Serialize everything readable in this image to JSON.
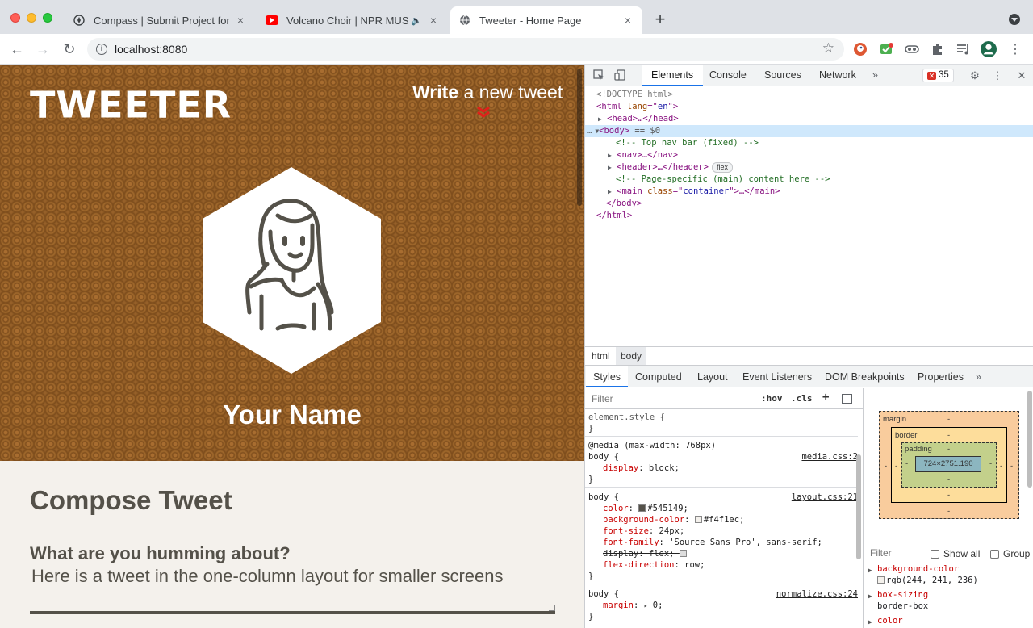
{
  "browser": {
    "tabs": [
      {
        "title": "Compass | Submit Project for E",
        "icon": "compass-icon",
        "active": false
      },
      {
        "title": "Volcano Choir | NPR MUSIC",
        "icon": "youtube-icon",
        "active": false,
        "audio": true
      },
      {
        "title": "Tweeter - Home Page",
        "icon": "globe-icon",
        "active": true
      }
    ],
    "url": "localhost:8080"
  },
  "page": {
    "logo": "TWEETER",
    "write_bold": "Write",
    "write_rest": " a new tweet",
    "name": "Your Name",
    "compose_title": "Compose Tweet",
    "question": "What are you humming about?",
    "tweet_text": "Here is a tweet in the one-column layout for smaller screens",
    "colors": {
      "hero": "#8e5a24",
      "accent": "#e0201a",
      "body_bg": "#f4f1ec",
      "text": "#545149"
    }
  },
  "devtools": {
    "tabs": [
      "Elements",
      "Console",
      "Sources",
      "Network"
    ],
    "more": "»",
    "error_count": "35",
    "dom": {
      "doctype": "<!DOCTYPE html>",
      "html_open_tag": "<html",
      "lang_attr": " lang",
      "lang_eq": "=\"",
      "lang_val": "en",
      "lang_close": "\">",
      "head_line": "<head>…</head>",
      "body_open": "<body>",
      "body_suffix": " == $0",
      "dots": "…",
      "comment1": "<!-- Top nav bar (fixed) -->",
      "nav_line": "<nav>…</nav>",
      "header_line": "<header>…</header>",
      "flex_pill": "flex",
      "comment2": "<!-- Page-specific (main) content here -->",
      "main_tag": "<main",
      "class_attr": " class",
      "main_eq": "=\"",
      "class_val": "container",
      "main_end": "\">…</main>",
      "body_close": "</body>",
      "html_close": "</html>"
    },
    "breadcrumbs": [
      "html",
      "body"
    ],
    "style_tabs": [
      "Styles",
      "Computed",
      "Layout",
      "Event Listeners",
      "DOM Breakpoints",
      "Properties"
    ],
    "styles": {
      "filter": "Filter",
      "hov": ":hov",
      "cls": ".cls",
      "plus": "+",
      "element_style": "element.style {",
      "close": "}",
      "media": "@media (max-width: 768px)",
      "r1_sel": "body {",
      "r1_src": "media.css:2",
      "r1_prop": "display",
      "r1_val": ": block;",
      "r2_sel": "body {",
      "r2_src": "layout.css:21",
      "color_prop": "color",
      "color_val": "#545149;",
      "bg_prop": "background-color",
      "bg_val": "#f4f1ec;",
      "fs_prop": "font-size",
      "fs_val": ": 24px;",
      "ff_prop": "font-family",
      "ff_val": ": 'Source Sans Pro', sans-serif;",
      "disp_struck": "display: flex;",
      "fd_prop": "flex-direction",
      "fd_val": ": row;",
      "r3_sel": "body {",
      "r3_src": "normalize.css:24",
      "margin_prop": "margin",
      "margin_val": "0;",
      "sep": ": ",
      "tri_right": "▸"
    },
    "box_model": {
      "margin": "margin",
      "border": "border",
      "padding": "padding",
      "content": "724×2751.190",
      "dash": "-"
    },
    "computed": {
      "filter": "Filter",
      "show_all": "Show all",
      "group": "Group",
      "items": [
        {
          "name": "background-color",
          "value": "rgb(244, 241, 236)"
        },
        {
          "name": "box-sizing",
          "value": "border-box"
        },
        {
          "name": "color",
          "value": ""
        }
      ]
    }
  }
}
